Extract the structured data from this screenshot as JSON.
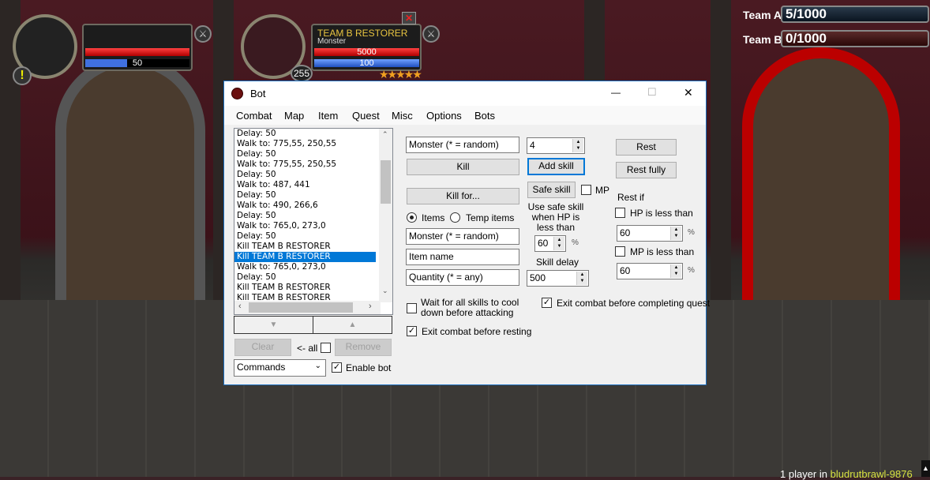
{
  "game": {
    "player": {
      "mp": "50",
      "alert_icon": "exclamation-icon"
    },
    "target": {
      "name": "TEAM B RESTORER",
      "type": "Monster",
      "hp": "5000",
      "mp": "100",
      "level": "255",
      "stars": 5
    },
    "teams": [
      {
        "label": "Team A",
        "score": "5/1000"
      },
      {
        "label": "Team B",
        "score": "0/1000"
      }
    ],
    "footer": {
      "prefix": "1 player in",
      "room": "bludrutbrawl-9876"
    }
  },
  "window": {
    "title": "Bot",
    "controls": {
      "minimize": "—",
      "maximize": "☐",
      "close": "✕"
    },
    "menu": [
      "Combat",
      "Map",
      "Item",
      "Quest",
      "Misc",
      "Options",
      "Bots"
    ],
    "commands": [
      "Delay: 50",
      "Walk to: 775,55, 250,55",
      "Delay: 50",
      "Walk to: 775,55, 250,55",
      "Delay: 50",
      "Walk to: 487, 441",
      "Delay: 50",
      "Walk to: 490, 266,6",
      "Delay: 50",
      "Walk to: 765,0, 273,0",
      "Delay: 50",
      "Kill TEAM B RESTORER",
      "Kill TEAM B RESTORER",
      "Walk to: 765,0, 273,0",
      "Delay: 50",
      "Kill TEAM B RESTORER",
      "Kill TEAM B RESTORER"
    ],
    "selected_index": 12,
    "move_down": "▼",
    "move_up": "▲",
    "clear": "Clear",
    "all_label": "<- all",
    "remove": "Remove",
    "mode_select": "Commands",
    "enable_bot": "Enable bot",
    "enable_bot_checked": true,
    "combat": {
      "monster_placeholder": "Monster (*  = random)",
      "kill": "Kill",
      "kill_for": "Kill for...",
      "items": "Items",
      "temp_items": "Temp items",
      "items_selected": "Items",
      "monster2_placeholder": "Monster (* = random)",
      "item_name_placeholder": "Item name",
      "quantity_placeholder": "Quantity (* = any)",
      "skill_value": "4",
      "add_skill": "Add skill",
      "safe_skill": "Safe skill",
      "mp": "MP",
      "safe_hp_label": "Use safe skill when HP is less than",
      "safe_hp_value": "60",
      "percent": "%",
      "skill_delay_label": "Skill delay",
      "skill_delay_value": "500",
      "rest": "Rest",
      "rest_fully": "Rest fully",
      "rest_if": "Rest if",
      "hp_less": "HP is less than",
      "hp_value": "60",
      "mp_less": "MP is less than",
      "mp_value": "60",
      "wait_cooldown": "Wait for all skills to cool down before attacking",
      "exit_quest": "Exit combat before completing quest",
      "exit_quest_checked": true,
      "exit_rest": "Exit combat before resting",
      "exit_rest_checked": true
    }
  }
}
